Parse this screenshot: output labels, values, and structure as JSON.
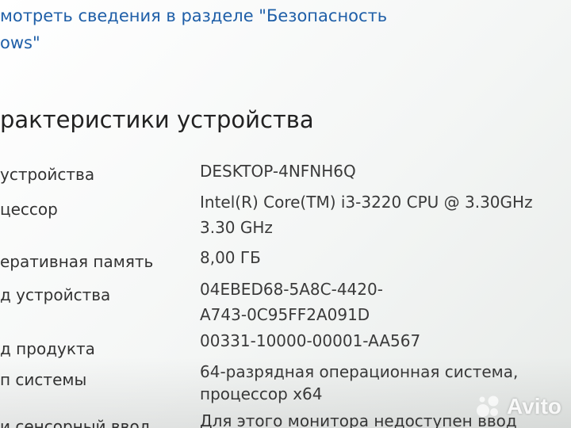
{
  "link": {
    "line1": "мотреть сведения в разделе \"Безопасность",
    "line2": "ows\""
  },
  "section": {
    "title": "рактеристики устройства"
  },
  "specs": {
    "device_name_label": "устройства",
    "device_name_value": "DESKTOP-4NFNH6Q",
    "cpu_label": "цессор",
    "cpu_value_line1": "Intel(R) Core(TM) i3-3220 CPU @ 3.30GHz",
    "cpu_value_line2": "3.30 GHz",
    "ram_label": "еративная память",
    "ram_value": "8,00 ГБ",
    "device_id_label": "д устройства",
    "device_id_value_line1": "04EBED68-5A8C-4420-",
    "device_id_value_line2": "A743-0C95FF2A091D",
    "product_id_label": "д продукта",
    "product_id_value": "00331-10000-00001-AA567",
    "system_type_label": "п системы",
    "system_type_value_line1": "64-разрядная операционная система,",
    "system_type_value_line2": "процессор x64",
    "pen_touch_label": "и сенсорный ввод",
    "pen_touch_value": "Для этого монитора недоступен ввод"
  },
  "watermark": {
    "text": "Avito",
    "icon": "avito-logo-icon"
  }
}
